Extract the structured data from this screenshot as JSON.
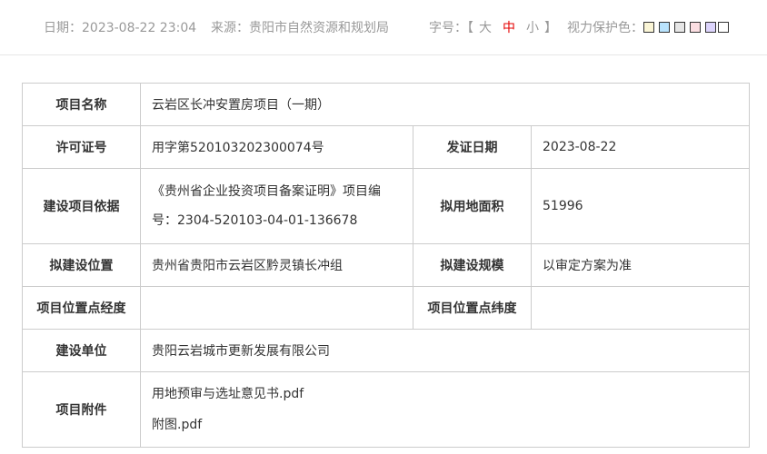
{
  "meta": {
    "date_label": "日期：",
    "date_value": "2023-08-22 23:04",
    "source_label": "来源：",
    "source_value": "贵阳市自然资源和规划局",
    "fontsize_label": "字号：",
    "bracket_open": "【",
    "bracket_close": "】",
    "fontsize_options": [
      "大",
      "中",
      "小"
    ],
    "fontsize_active": "中",
    "eye_care_label": "视力保护色：",
    "eye_care_colors": [
      "#FAF5D6",
      "#B9E3FD",
      "#E6E6E6",
      "#FBDEE2",
      "#DCD4FC",
      "#FFFFFF"
    ],
    "active_color": "#E50000"
  },
  "table": {
    "project_name_label": "项目名称",
    "project_name": "云岩区长冲安置房项目（一期）",
    "permit_no_label": "许可证号",
    "permit_no": "用字第520103202300074号",
    "issue_date_label": "发证日期",
    "issue_date": "2023-08-22",
    "basis_label": "建设项目依据",
    "basis": "《贵州省企业投资项目备案证明》项目编号：2304-520103-04-01-136678",
    "land_area_label": "拟用地面积",
    "land_area": "51996",
    "location_label": "拟建设位置",
    "location": "贵州省贵阳市云岩区黔灵镇长冲组",
    "scale_label": "拟建设规模",
    "scale": "以审定方案为准",
    "longitude_label": "项目位置点经度",
    "longitude": "",
    "latitude_label": "项目位置点纬度",
    "latitude": "",
    "unit_label": "建设单位",
    "unit": "贵阳云岩城市更新发展有限公司",
    "attachments_label": "项目附件",
    "attachments": [
      "用地预审与选址意见书.pdf",
      "附图.pdf"
    ]
  }
}
